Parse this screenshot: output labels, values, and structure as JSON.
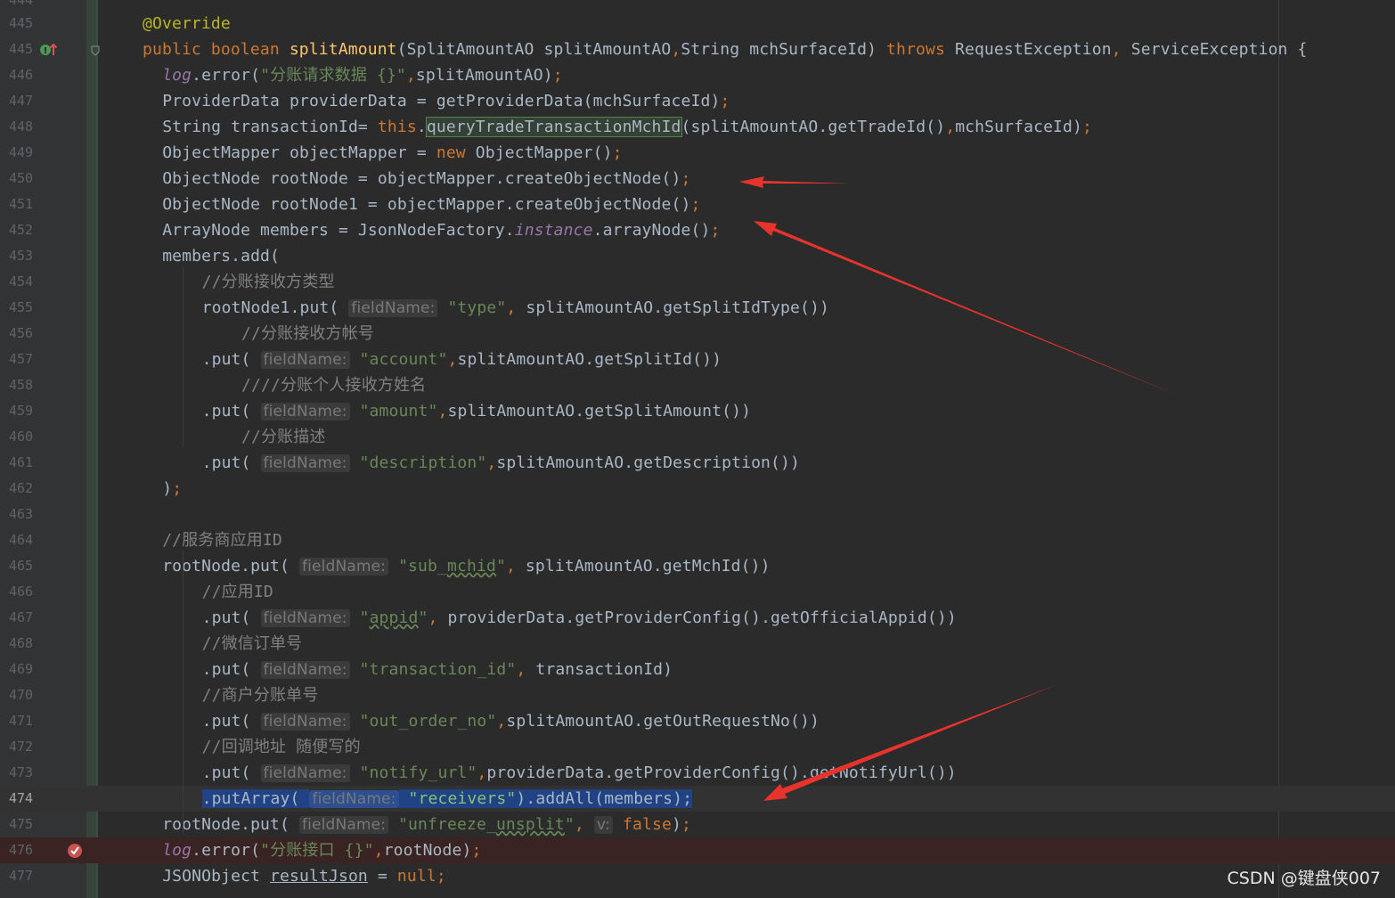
{
  "editor": {
    "lines": [
      {
        "num": "445",
        "indent": 1,
        "segs": [
          [
            "ann",
            "@Override"
          ]
        ]
      },
      {
        "num": "445",
        "indent": 1,
        "segs": [
          [
            "kw",
            "public boolean "
          ],
          [
            "fn",
            "splitAmount"
          ],
          [
            "p",
            "(SplitAmountAO splitAmountAO"
          ],
          [
            "kw",
            ","
          ],
          [
            "p",
            "String mchSurfaceId) "
          ],
          [
            "kw",
            "throws "
          ],
          [
            "p",
            "RequestException"
          ],
          [
            "kw",
            ", "
          ],
          [
            "p",
            "ServiceException {"
          ]
        ]
      },
      {
        "num": "446",
        "indent": 2,
        "segs": [
          [
            "logf",
            "log"
          ],
          [
            "p",
            ".error("
          ],
          [
            "str",
            "\"分账请求数据 {}\""
          ],
          [
            "kw",
            ","
          ],
          [
            "p",
            "splitAmountAO)"
          ],
          [
            "kw",
            ";"
          ]
        ]
      },
      {
        "num": "447",
        "indent": 2,
        "segs": [
          [
            "p",
            "ProviderData providerData = getProviderData(mchSurfaceId)"
          ],
          [
            "kw",
            ";"
          ]
        ]
      },
      {
        "num": "448",
        "indent": 2,
        "segs": [
          [
            "p",
            "String transactionId= "
          ],
          [
            "kw",
            "this"
          ],
          [
            "p",
            "."
          ],
          [
            "hl",
            "queryTradeTransactionMchId"
          ],
          [
            "p",
            "(splitAmountAO.getTradeId()"
          ],
          [
            "kw",
            ","
          ],
          [
            "p",
            "mchSurfaceId)"
          ],
          [
            "kw",
            ";"
          ]
        ]
      },
      {
        "num": "449",
        "indent": 2,
        "segs": [
          [
            "p",
            "ObjectMapper objectMapper = "
          ],
          [
            "kw",
            "new "
          ],
          [
            "p",
            "ObjectMapper()"
          ],
          [
            "kw",
            ";"
          ]
        ]
      },
      {
        "num": "450",
        "indent": 2,
        "segs": [
          [
            "p",
            "ObjectNode rootNode = objectMapper.createObjectNode()"
          ],
          [
            "kw",
            ";"
          ]
        ]
      },
      {
        "num": "451",
        "indent": 2,
        "segs": [
          [
            "p",
            "ObjectNode rootNode1 = objectMapper.createObjectNode()"
          ],
          [
            "kw",
            ";"
          ]
        ]
      },
      {
        "num": "452",
        "indent": 2,
        "segs": [
          [
            "p",
            "ArrayNode members = JsonNodeFactory."
          ],
          [
            "fld",
            "instance"
          ],
          [
            "p",
            ".arrayNode()"
          ],
          [
            "kw",
            ";"
          ]
        ]
      },
      {
        "num": "453",
        "indent": 2,
        "segs": [
          [
            "p",
            "members.add("
          ]
        ]
      },
      {
        "num": "454",
        "indent": 4,
        "segs": [
          [
            "cmt",
            "//分账接收方类型"
          ]
        ]
      },
      {
        "num": "455",
        "indent": 4,
        "segs": [
          [
            "p",
            "rootNode1.put( "
          ],
          [
            "hint",
            "fieldName:"
          ],
          [
            "str",
            " \"type\""
          ],
          [
            "kw",
            ", "
          ],
          [
            "p",
            "splitAmountAO.getSplitIdType())"
          ]
        ]
      },
      {
        "num": "456",
        "indent": 6,
        "segs": [
          [
            "cmt",
            "//分账接收方帐号"
          ]
        ]
      },
      {
        "num": "457",
        "indent": 4,
        "segs": [
          [
            "p",
            ".put( "
          ],
          [
            "hint",
            "fieldName:"
          ],
          [
            "str",
            " \"account\""
          ],
          [
            "kw",
            ","
          ],
          [
            "p",
            "splitAmountAO.getSplitId())"
          ]
        ]
      },
      {
        "num": "458",
        "indent": 6,
        "segs": [
          [
            "cmt",
            "////分账个人接收方姓名"
          ]
        ]
      },
      {
        "num": "459",
        "indent": 4,
        "segs": [
          [
            "p",
            ".put( "
          ],
          [
            "hint",
            "fieldName:"
          ],
          [
            "str",
            " \"amount\""
          ],
          [
            "kw",
            ","
          ],
          [
            "p",
            "splitAmountAO.getSplitAmount())"
          ]
        ]
      },
      {
        "num": "460",
        "indent": 6,
        "segs": [
          [
            "cmt",
            "//分账描述"
          ]
        ]
      },
      {
        "num": "461",
        "indent": 4,
        "segs": [
          [
            "p",
            ".put( "
          ],
          [
            "hint",
            "fieldName:"
          ],
          [
            "str",
            " \"description\""
          ],
          [
            "kw",
            ","
          ],
          [
            "p",
            "splitAmountAO.getDescription())"
          ]
        ]
      },
      {
        "num": "462",
        "indent": 2,
        "segs": [
          [
            "p",
            ")"
          ],
          [
            "kw",
            ";"
          ]
        ]
      },
      {
        "num": "463",
        "indent": 0,
        "segs": []
      },
      {
        "num": "464",
        "indent": 2,
        "segs": [
          [
            "cmt",
            "//服务商应用ID"
          ]
        ]
      },
      {
        "num": "465",
        "indent": 2,
        "segs": [
          [
            "p",
            "rootNode.put( "
          ],
          [
            "hint",
            "fieldName:"
          ],
          [
            "str",
            " \"sub_"
          ],
          [
            "sq",
            "mchid"
          ],
          [
            "str",
            "\""
          ],
          [
            "kw",
            ", "
          ],
          [
            "p",
            "splitAmountAO.getMchId())"
          ]
        ]
      },
      {
        "num": "466",
        "indent": 4,
        "segs": [
          [
            "cmt",
            "//应用ID"
          ]
        ]
      },
      {
        "num": "467",
        "indent": 4,
        "segs": [
          [
            "p",
            ".put( "
          ],
          [
            "hint",
            "fieldName:"
          ],
          [
            "str",
            " \""
          ],
          [
            "sq",
            "appid"
          ],
          [
            "str",
            "\""
          ],
          [
            "kw",
            ", "
          ],
          [
            "p",
            "providerData.getProviderConfig().getOfficialAppid())"
          ]
        ]
      },
      {
        "num": "468",
        "indent": 4,
        "segs": [
          [
            "cmt",
            "//微信订单号"
          ]
        ]
      },
      {
        "num": "469",
        "indent": 4,
        "segs": [
          [
            "p",
            ".put( "
          ],
          [
            "hint",
            "fieldName:"
          ],
          [
            "str",
            " \"transaction_id\""
          ],
          [
            "kw",
            ", "
          ],
          [
            "p",
            "transactionId)"
          ]
        ]
      },
      {
        "num": "470",
        "indent": 4,
        "segs": [
          [
            "cmt",
            "//商户分账单号"
          ]
        ]
      },
      {
        "num": "471",
        "indent": 4,
        "segs": [
          [
            "p",
            ".put( "
          ],
          [
            "hint",
            "fieldName:"
          ],
          [
            "str",
            " \"out_order_no\""
          ],
          [
            "kw",
            ","
          ],
          [
            "p",
            "splitAmountAO.getOutRequestNo())"
          ]
        ]
      },
      {
        "num": "472",
        "indent": 4,
        "segs": [
          [
            "cmt",
            "//回调地址 随便写的"
          ]
        ]
      },
      {
        "num": "473",
        "indent": 4,
        "segs": [
          [
            "p",
            ".put( "
          ],
          [
            "hint",
            "fieldName:"
          ],
          [
            "str",
            " \"notify_url\""
          ],
          [
            "kw",
            ","
          ],
          [
            "p",
            "providerData.getProviderConfig().getNotifyUrl())"
          ]
        ]
      },
      {
        "num": "474",
        "indent": 4,
        "caret": true,
        "segs": [
          [
            "sel",
            ".putArray( "
          ],
          [
            "selhint",
            "fieldName:"
          ],
          [
            "selstr",
            " \"receivers\""
          ],
          [
            "sel",
            ").addAll(members);"
          ]
        ]
      },
      {
        "num": "475",
        "indent": 2,
        "segs": [
          [
            "p",
            "rootNode.put( "
          ],
          [
            "hint",
            "fieldName:"
          ],
          [
            "str",
            " \"unfreeze_"
          ],
          [
            "sq",
            "unsplit"
          ],
          [
            "str",
            "\""
          ],
          [
            "kw",
            ", "
          ],
          [
            "hint",
            "v:"
          ],
          [
            "kw",
            " false"
          ],
          [
            "p",
            ")"
          ],
          [
            "kw",
            ";"
          ]
        ]
      },
      {
        "num": "476",
        "indent": 2,
        "bp": true,
        "segs": [
          [
            "logf",
            "log"
          ],
          [
            "p",
            ".error("
          ],
          [
            "str",
            "\"分账接口 {}\""
          ],
          [
            "kw",
            ","
          ],
          [
            "p",
            "rootNode)"
          ],
          [
            "kw",
            ";"
          ]
        ]
      },
      {
        "num": "477",
        "indent": 2,
        "segs": [
          [
            "p",
            "JSONObject "
          ],
          [
            "u",
            "resultJson"
          ],
          [
            "p",
            " = "
          ],
          [
            "kw",
            "null;"
          ]
        ]
      }
    ],
    "first_line_num": "444",
    "colors": {
      "background": "#2b2b2b",
      "keyword": "#cc7832",
      "string": "#6a8759",
      "comment": "#808080",
      "method_decl": "#ffc66d",
      "annotation": "#bbb529",
      "arrow": "#e8332c"
    },
    "icons": [
      "override-icon",
      "fold-icon",
      "breakpoint-icon",
      "annotation-arrow-icon"
    ]
  },
  "watermark": "CSDN @键盘侠007"
}
